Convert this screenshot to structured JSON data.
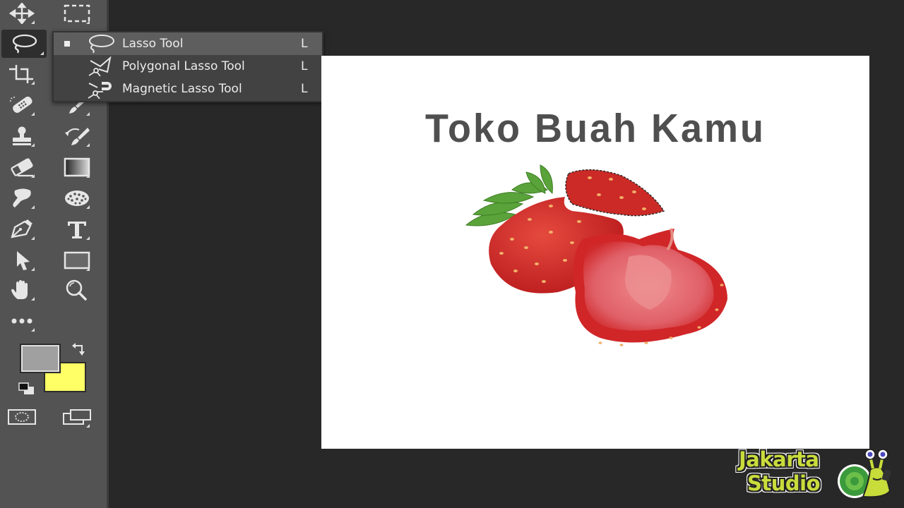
{
  "app": "Adobe Photoshop",
  "toolbar": {
    "tools": [
      {
        "name": "move-tool",
        "icon": "move-icon"
      },
      {
        "name": "rectangular-marquee-tool",
        "icon": "marquee-icon"
      },
      {
        "name": "lasso-tool",
        "icon": "lasso-icon",
        "active": true
      },
      {
        "name": "crop-tool",
        "icon": "crop-icon"
      },
      {
        "name": "spot-healing-brush-tool",
        "icon": "bandage-icon"
      },
      {
        "name": "brush-tool",
        "icon": "brush-icon"
      },
      {
        "name": "clone-stamp-tool",
        "icon": "stamp-icon"
      },
      {
        "name": "history-brush-tool",
        "icon": "history-brush-icon"
      },
      {
        "name": "eraser-tool",
        "icon": "eraser-icon"
      },
      {
        "name": "gradient-tool",
        "icon": "gradient-icon"
      },
      {
        "name": "smudge-tool",
        "icon": "smudge-icon"
      },
      {
        "name": "sponge-tool",
        "icon": "sponge-icon"
      },
      {
        "name": "pen-tool",
        "icon": "pen-icon"
      },
      {
        "name": "type-tool",
        "icon": "type-icon"
      },
      {
        "name": "path-selection-tool",
        "icon": "arrow-icon"
      },
      {
        "name": "rectangle-tool",
        "icon": "rectangle-icon"
      },
      {
        "name": "hand-tool",
        "icon": "hand-icon"
      },
      {
        "name": "zoom-tool",
        "icon": "magnifier-icon"
      },
      {
        "name": "edit-toolbar",
        "icon": "more-icon"
      }
    ],
    "foreground_color": "#a0a0a0",
    "background_color": "#ffff66"
  },
  "flyout": {
    "items": [
      {
        "label": "Lasso Tool",
        "shortcut": "L",
        "selected": true
      },
      {
        "label": "Polygonal Lasso Tool",
        "shortcut": "L"
      },
      {
        "label": "Magnetic Lasso Tool",
        "shortcut": "L"
      }
    ]
  },
  "document": {
    "title_text": "Toko Buah Kamu",
    "background": "#ffffff"
  },
  "watermark": {
    "line1": "Jakarta",
    "line2": "Studio"
  }
}
